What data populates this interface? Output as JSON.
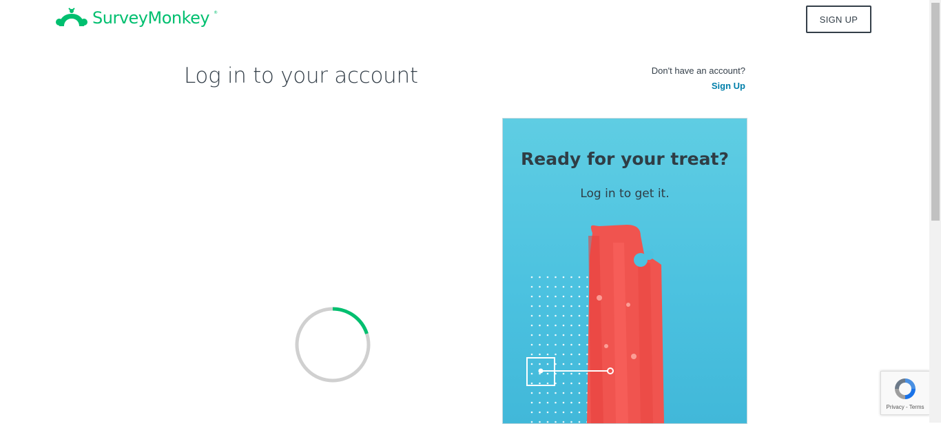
{
  "header": {
    "brand_name": "SurveyMonkey",
    "brand_reg": "®",
    "signup_button": "SIGN UP"
  },
  "login": {
    "title": "Log in to your account",
    "no_account_text": "Don't have an account?",
    "signup_link": "Sign Up",
    "loading_progress": 0.2
  },
  "promo": {
    "title": "Ready for your treat?",
    "subtitle": "Log in to get it."
  },
  "recaptcha": {
    "privacy": "Privacy",
    "separator": " - ",
    "terms": "Terms"
  },
  "colors": {
    "brand": "#00bf6f",
    "link": "#007faa",
    "text": "#333e48",
    "promo_bg": "#4cc2e0"
  }
}
